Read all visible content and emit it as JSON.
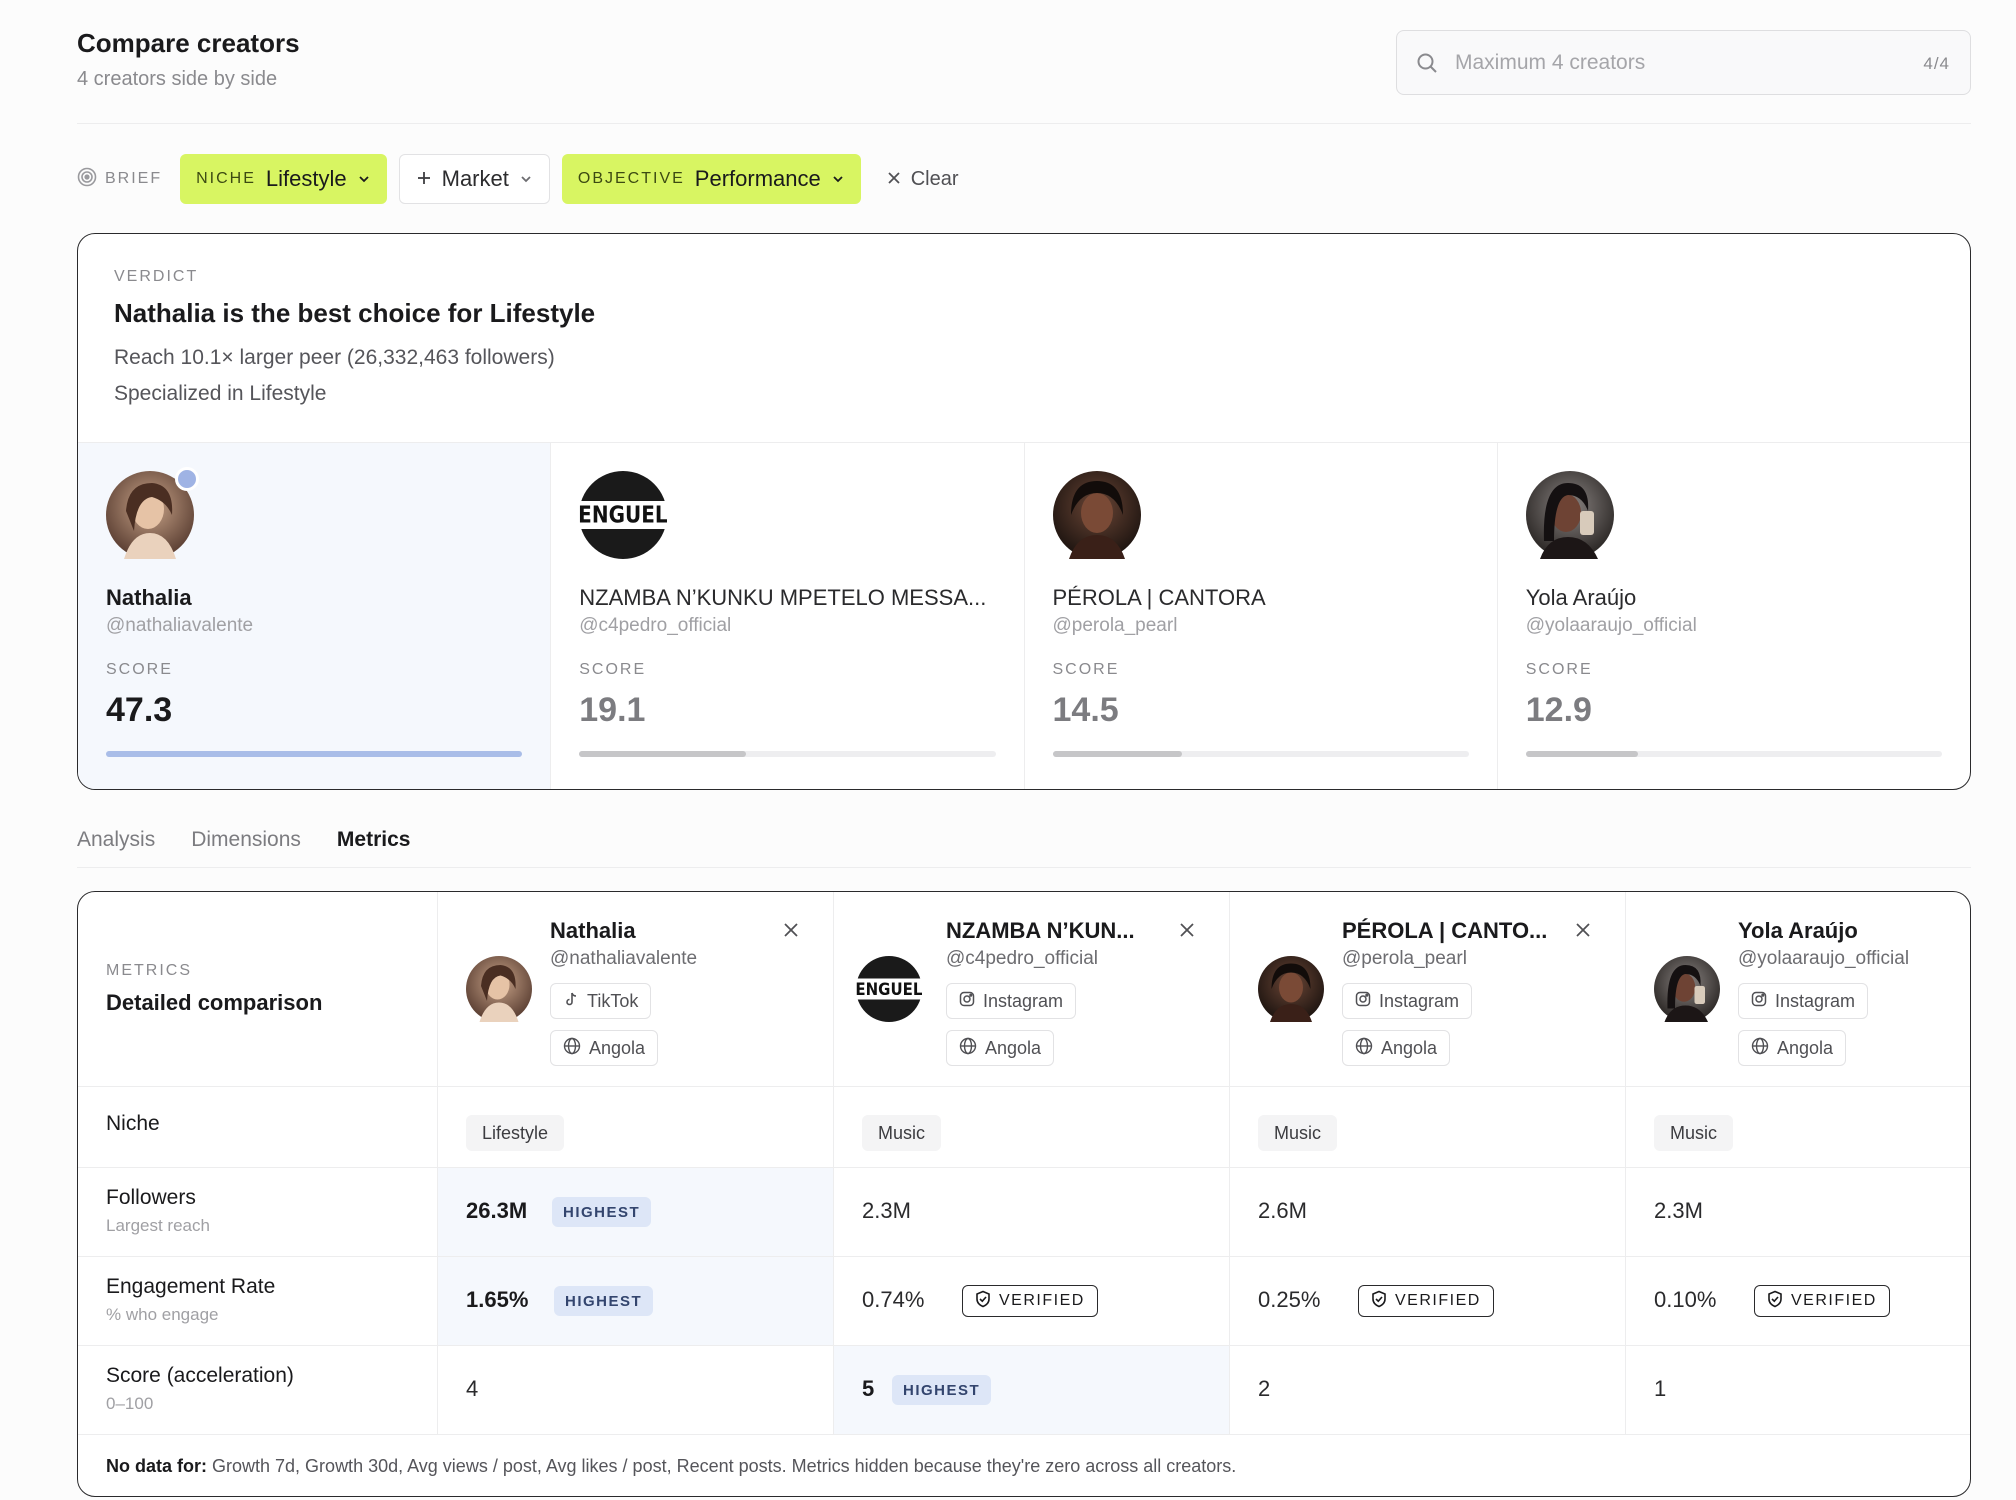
{
  "header": {
    "title": "Compare creators",
    "subtitle": "4 creators side by side",
    "search_placeholder": "Maximum 4 creators",
    "search_count": "4/4"
  },
  "brief": {
    "label": "BRIEF",
    "niche_key": "NICHE",
    "niche_value": "Lifestyle",
    "market_label": "Market",
    "objective_key": "OBJECTIVE",
    "objective_value": "Performance",
    "clear_label": "Clear"
  },
  "verdict": {
    "eyebrow": "VERDICT",
    "headline": "Nathalia is the best choice for Lifestyle",
    "lines": [
      "Reach 10.1× larger peer (26,332,463 followers)",
      "Specialized in Lifestyle"
    ],
    "score_label": "SCORE",
    "cards": [
      {
        "name": "Nathalia",
        "handle": "@nathaliavalente",
        "score": "47.3",
        "score_fraction": 1.0
      },
      {
        "name": "NZAMBA N’KUNKU MPETELO MESSA...",
        "handle": "@c4pedro_official",
        "score": "19.1",
        "score_fraction": 0.4
      },
      {
        "name": "PÉROLA | CANTORA",
        "handle": "@perola_pearl",
        "score": "14.5",
        "score_fraction": 0.31
      },
      {
        "name": "Yola Araújo",
        "handle": "@yolaaraujo_official",
        "score": "12.9",
        "score_fraction": 0.27
      }
    ]
  },
  "tabs": [
    "Analysis",
    "Dimensions",
    "Metrics"
  ],
  "metrics": {
    "eyebrow": "METRICS",
    "heading": "Detailed comparison",
    "creators": [
      {
        "name": "Nathalia",
        "handle": "@nathaliavalente",
        "platform": "TikTok",
        "country": "Angola"
      },
      {
        "name": "NZAMBA N’KUN...",
        "handle": "@c4pedro_official",
        "platform": "Instagram",
        "country": "Angola"
      },
      {
        "name": "PÉROLA | CANTO...",
        "handle": "@perola_pearl",
        "platform": "Instagram",
        "country": "Angola"
      },
      {
        "name": "Yola Araújo",
        "handle": "@yolaaraujo_official",
        "platform": "Instagram",
        "country": "Angola"
      }
    ],
    "rows": {
      "niche": {
        "label": "Niche",
        "values": [
          "Lifestyle",
          "Music",
          "Music",
          "Music"
        ]
      },
      "followers": {
        "label": "Followers",
        "sub": "Largest reach",
        "values": [
          "26.3M",
          "2.3M",
          "2.6M",
          "2.3M"
        ]
      },
      "engagement": {
        "label": "Engagement Rate",
        "sub": "% who engage",
        "values": [
          "1.65%",
          "0.74%",
          "0.25%",
          "0.10%"
        ]
      },
      "score": {
        "label": "Score (acceleration)",
        "sub": "0–100",
        "values": [
          "4",
          "5",
          "2",
          "1"
        ]
      }
    },
    "badges": {
      "highest": "HIGHEST",
      "verified": "VERIFIED"
    },
    "footer_label": "No data for:",
    "footer_text": "Growth 7d, Growth 30d, Avg views / post, Avg likes / post, Recent posts. Metrics hidden because they're zero across all creators."
  },
  "colors": {
    "accent_chip": "#d8f562",
    "highlight_bg": "#f5f8fd",
    "highest_badge": "#dde6f7",
    "best_bar": "#a9bde8"
  },
  "icons": [
    "search-icon",
    "target-icon",
    "chevron-down-icon",
    "plus-icon",
    "close-icon",
    "tiktok-icon",
    "instagram-icon",
    "globe-icon",
    "shield-check-icon"
  ]
}
